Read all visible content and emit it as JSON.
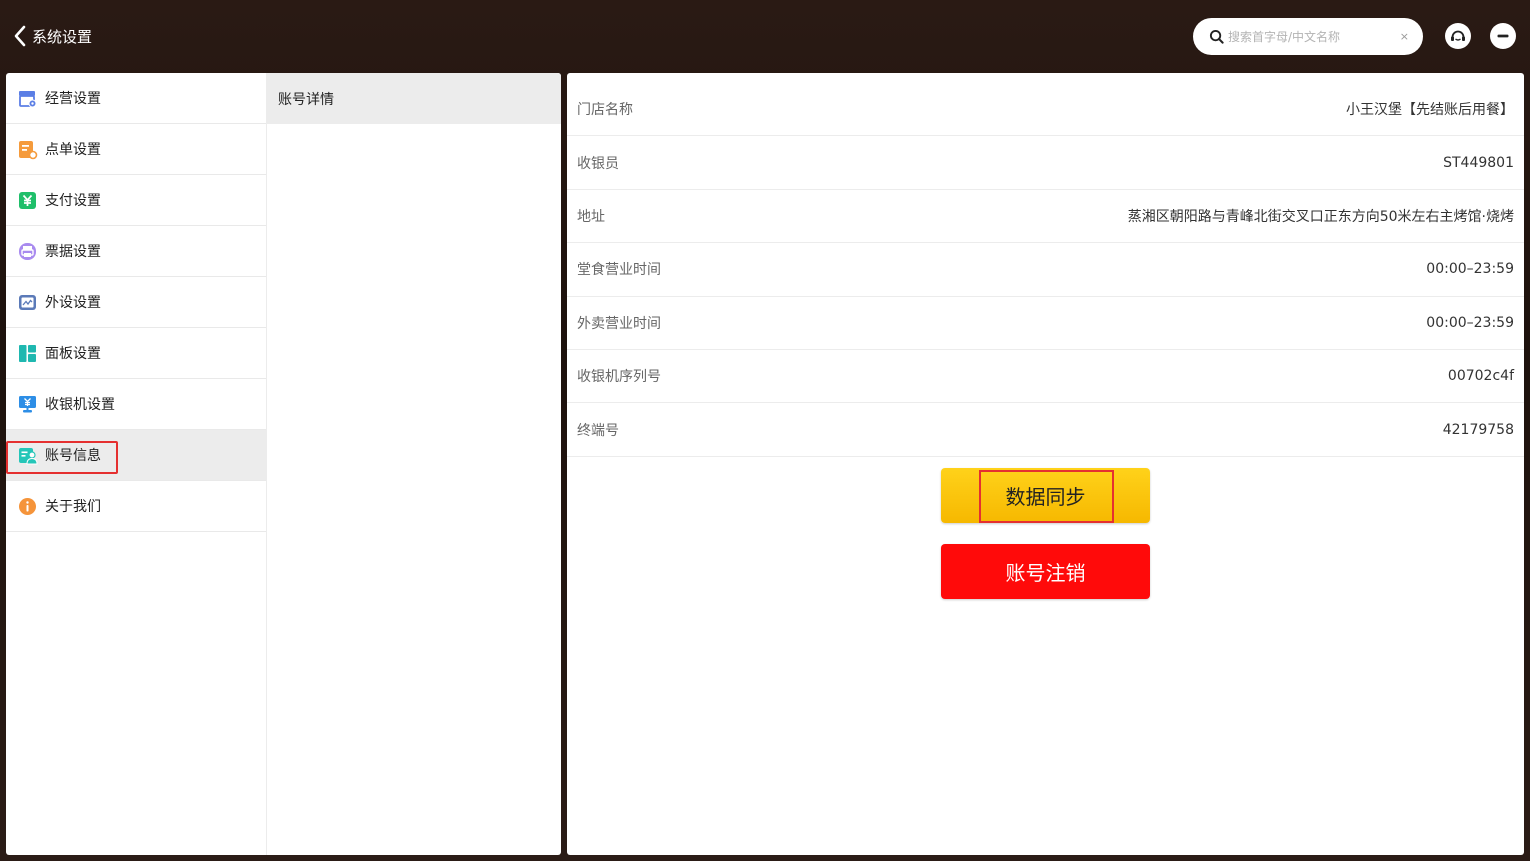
{
  "header": {
    "title": "系统设置",
    "search_placeholder": "搜索首字母/中文名称",
    "search_clear": "×"
  },
  "menu": {
    "items": [
      {
        "label": "经营设置",
        "icon": "store-settings-icon"
      },
      {
        "label": "点单设置",
        "icon": "order-settings-icon"
      },
      {
        "label": "支付设置",
        "icon": "payment-yen-icon"
      },
      {
        "label": "票据设置",
        "icon": "printer-receipt-icon"
      },
      {
        "label": "外设设置",
        "icon": "peripheral-monitor-icon"
      },
      {
        "label": "面板设置",
        "icon": "panel-layout-icon"
      },
      {
        "label": "收银机设置",
        "icon": "cashier-monitor-icon"
      },
      {
        "label": "账号信息",
        "icon": "account-info-icon"
      },
      {
        "label": "关于我们",
        "icon": "about-info-icon"
      }
    ],
    "active_index": 7
  },
  "submenu": {
    "items": [
      {
        "label": "账号详情"
      }
    ]
  },
  "details": {
    "rows": [
      {
        "label": "门店名称",
        "value": "小王汉堡【先结账后用餐】"
      },
      {
        "label": "收银员",
        "value": "ST449801"
      },
      {
        "label": "地址",
        "value": "蒸湘区朝阳路与青峰北街交叉口正东方向50米左右主烤馆·烧烤"
      },
      {
        "label": "堂食营业时间",
        "value": "00:00–23:59"
      },
      {
        "label": "外卖营业时间",
        "value": "00:00–23:59"
      },
      {
        "label": "收银机序列号",
        "value": "00702c4f"
      },
      {
        "label": "终端号",
        "value": "42179758"
      }
    ]
  },
  "actions": {
    "sync_label": "数据同步",
    "logout_label": "账号注销"
  },
  "colors": {
    "sync": "#ffc600",
    "logout": "#ff0a0a",
    "highlight": "#e53030"
  }
}
